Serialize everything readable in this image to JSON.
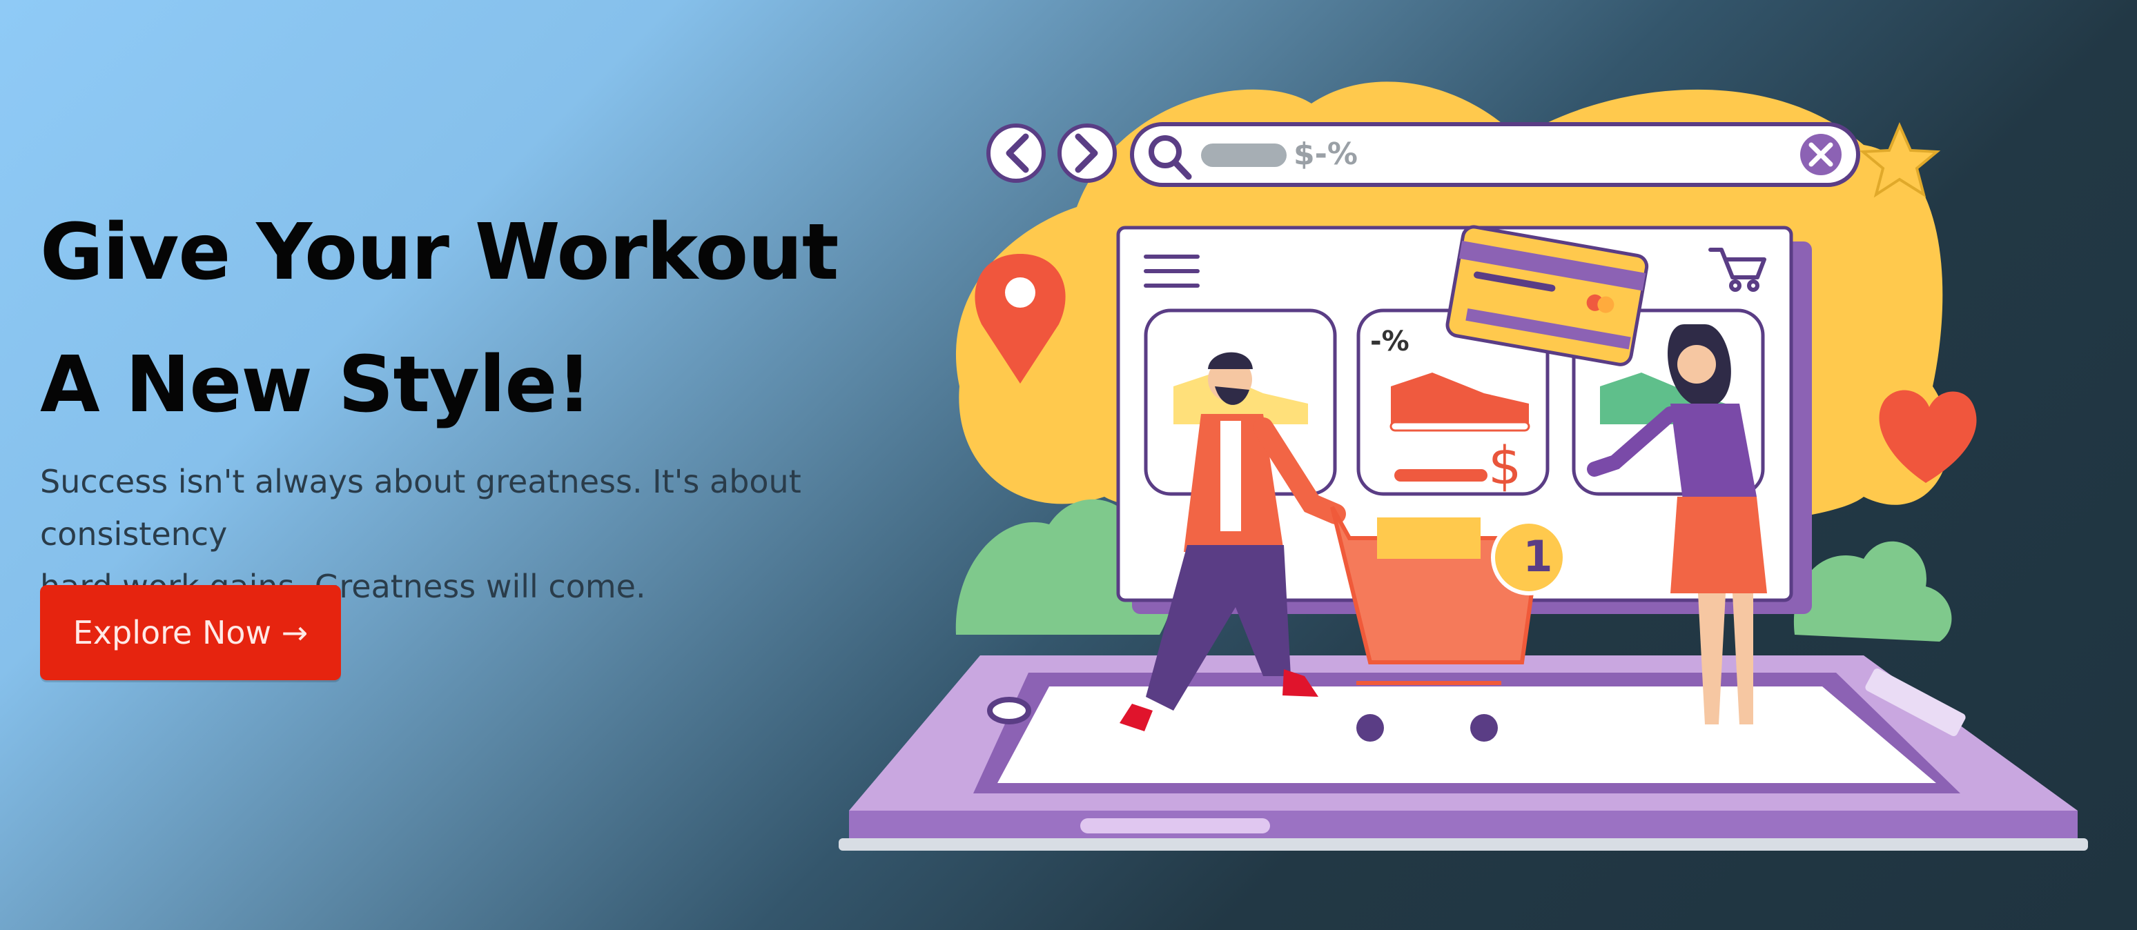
{
  "hero": {
    "title_line1": "Give Your Workout",
    "title_line2": "A New Style!",
    "subtitle_line1": "Success isn't always about greatness. It's about consistency",
    "subtitle_line2": "hard work gains. Greatness will come.",
    "cta_label": "Explore Now →"
  },
  "illustration": {
    "search_text": "$-%",
    "discount_label": "-%",
    "price_symbol": "$",
    "cart_badge": "1",
    "icons": [
      "back-arrow-icon",
      "forward-arrow-icon",
      "search-icon",
      "clear-icon",
      "star-icon",
      "location-pin-icon",
      "menu-icon",
      "cart-icon",
      "heart-icon",
      "credit-card-icon",
      "sneaker-icon",
      "shopping-cart-icon"
    ]
  },
  "colors": {
    "cta": "#e6240f",
    "title": "#050505",
    "subtitle": "#2a3c4a",
    "purple": "#7e57a8",
    "yellow": "#ffc94d"
  }
}
